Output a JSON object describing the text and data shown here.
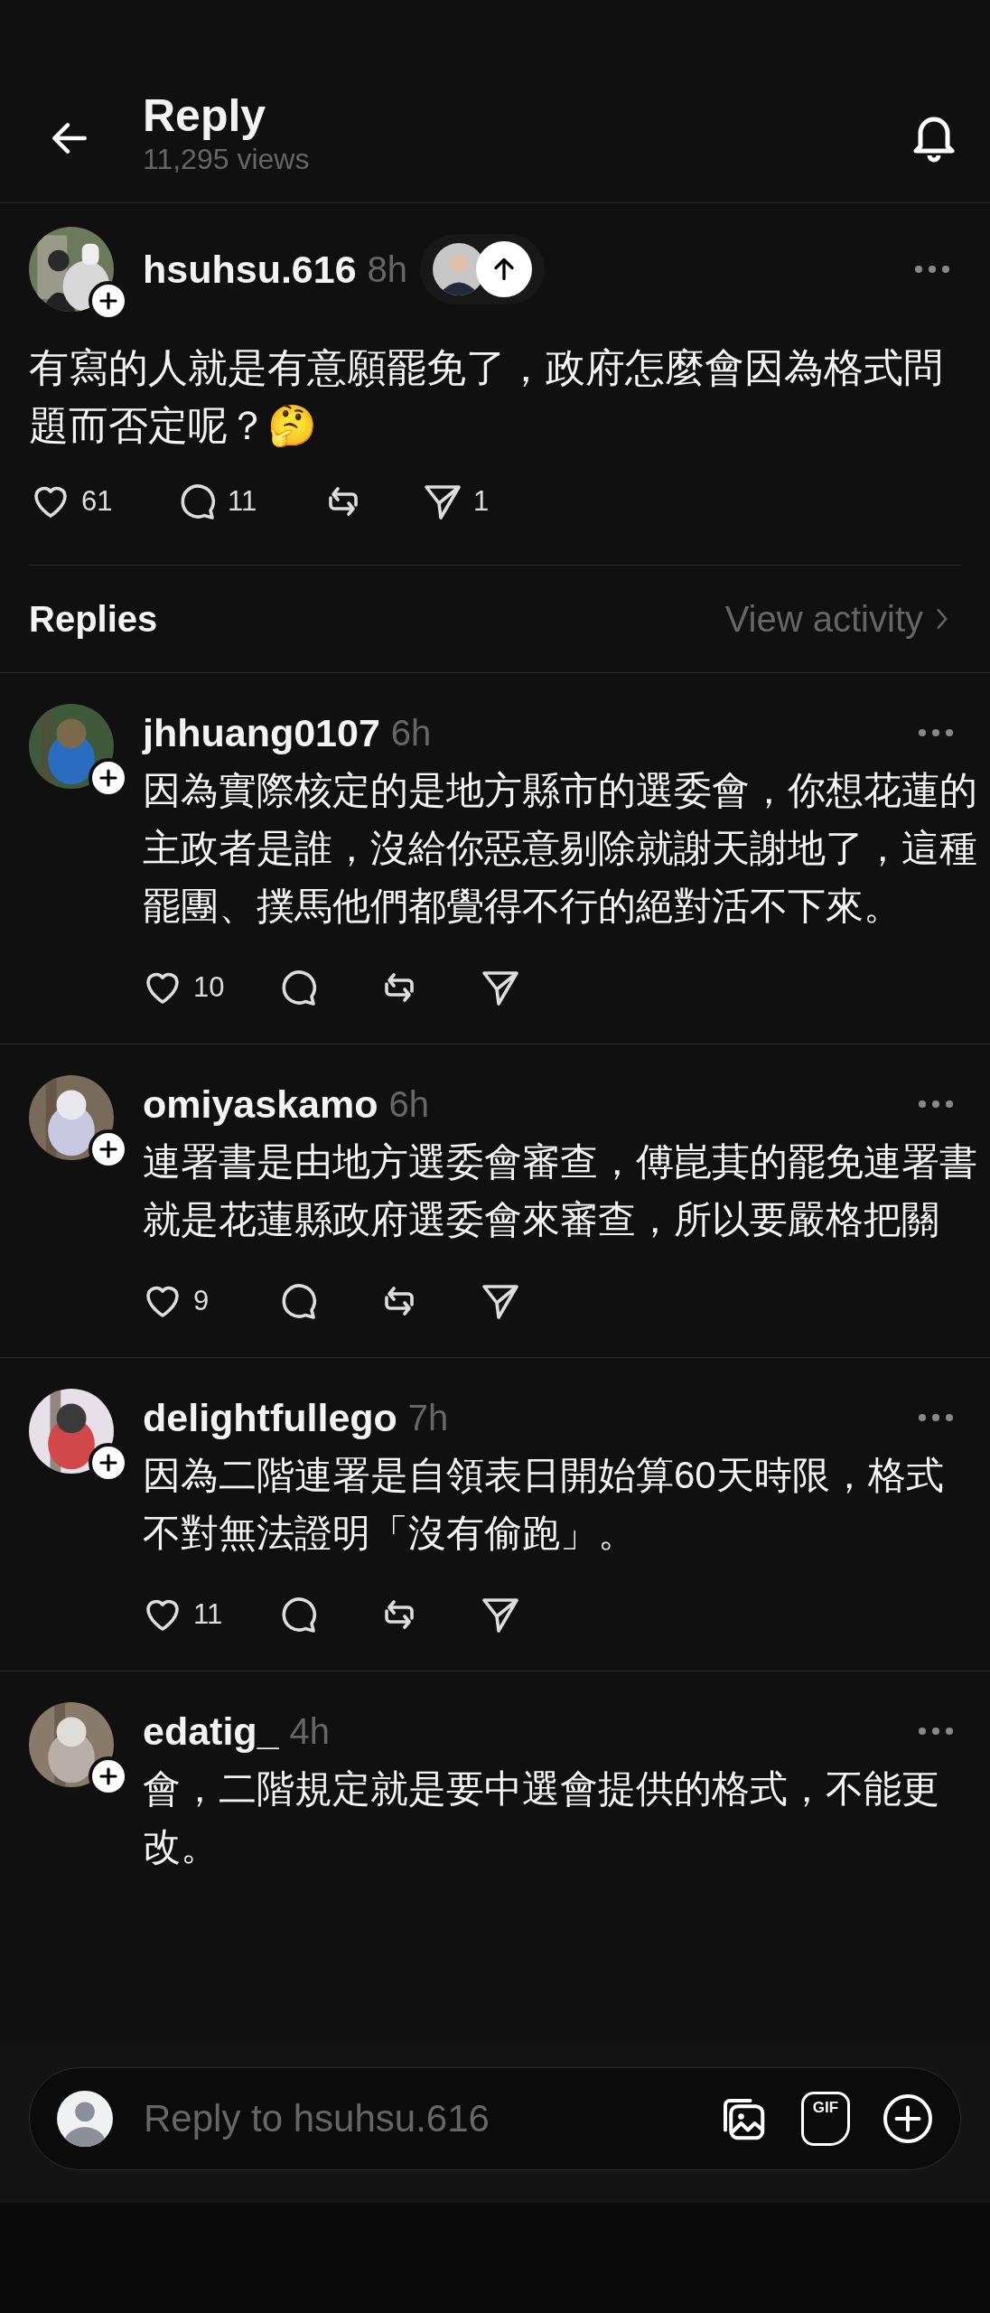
{
  "header": {
    "title": "Reply",
    "views": "11,295 views"
  },
  "post": {
    "username": "hsuhsu.616",
    "time": "8h",
    "text": "有寫的人就是有意願罷免了，政府怎麼會因為格式問題而否定呢？🤔",
    "actions": [
      {
        "kind": "like",
        "count": "61"
      },
      {
        "kind": "comment",
        "count": "11"
      },
      {
        "kind": "repost"
      },
      {
        "kind": "share",
        "count": "1"
      }
    ]
  },
  "replies_section": {
    "title": "Replies",
    "link": "View activity"
  },
  "replies": [
    {
      "username": "jhhuang0107",
      "time": "6h",
      "text": "因為實際核定的是地方縣市的選委會，你想花蓮的主政者是誰，沒給你惡意剔除就謝天謝地了，這種罷團、撲馬他們都覺得不行的絕對活不下來。",
      "actions": [
        {
          "kind": "like",
          "count": "10"
        },
        {
          "kind": "comment"
        },
        {
          "kind": "repost"
        },
        {
          "kind": "share"
        }
      ]
    },
    {
      "username": "omiyaskamo",
      "time": "6h",
      "text": "連署書是由地方選委會審查，傅崑萁的罷免連署書就是花蓮縣政府選委會來審查，所以要嚴格把關",
      "actions": [
        {
          "kind": "like",
          "count": "9"
        },
        {
          "kind": "comment"
        },
        {
          "kind": "repost"
        },
        {
          "kind": "share"
        }
      ]
    },
    {
      "username": "delightfullego",
      "time": "7h",
      "text": "因為二階連署是自領表日開始算60天時限，格式不對無法證明「沒有偷跑」。",
      "actions": [
        {
          "kind": "like",
          "count": "11"
        },
        {
          "kind": "comment"
        },
        {
          "kind": "repost"
        },
        {
          "kind": "share"
        }
      ]
    },
    {
      "username": "edatig_",
      "time": "4h",
      "text": "會，二階規定就是要中選會提供的格式，不能更改。"
    }
  ],
  "composer": {
    "placeholder": "Reply to hsuhsu.616",
    "gif_label": "GIF"
  }
}
